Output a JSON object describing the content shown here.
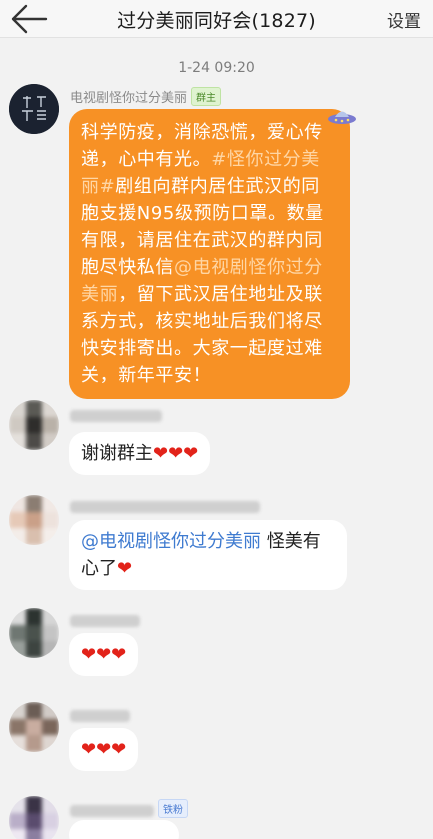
{
  "header": {
    "back_icon": "arrow-left-icon",
    "title": "过分美丽同好会(1827)",
    "settings_label": "设置"
  },
  "timestamp": "1-24 09:20",
  "owner_message": {
    "sender": "电视剧怪你过分美丽",
    "badge": "群主",
    "text_part1": "科学防疫，消除恐慌，爱心传递，心中有光。",
    "hashtag": "#怪你过分美丽#",
    "text_part2": "剧组向群内居住武汉的同胞支援N95级预防口罩。数量有限，请居住在武汉的群内同胞尽快私信",
    "mention": "@电视剧怪你过分美丽",
    "text_part3": "，留下武汉居住地址及联系方式，核实地址后我们将尽快安排寄出。大家一起度过难关，新年平安！",
    "decoration_icon": "ufo-icon"
  },
  "replies": [
    {
      "text": "谢谢群主",
      "hearts": "❤❤❤"
    },
    {
      "mention": "@电视剧怪你过分美丽",
      "text": " 怪美有心了",
      "hearts": "❤"
    },
    {
      "text": "",
      "hearts": "❤❤❤"
    },
    {
      "text": "",
      "hearts": "❤❤❤"
    }
  ],
  "last_message": {
    "badge": "铁粉"
  },
  "colors": {
    "accent_orange": "#f79125",
    "mention_blue": "#3f7bd0",
    "heart_red": "#e2231a",
    "background": "#f2f2f2"
  }
}
